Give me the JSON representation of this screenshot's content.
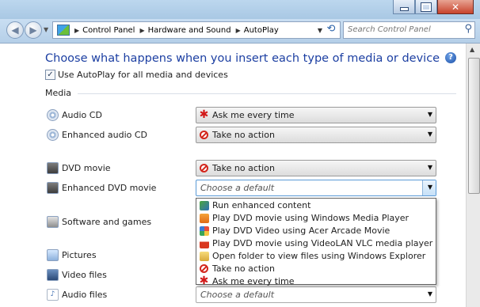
{
  "nav": {
    "breadcrumbs": [
      "Control Panel",
      "Hardware and Sound",
      "AutoPlay"
    ],
    "search_placeholder": "Search Control Panel"
  },
  "page": {
    "heading": "Choose what happens when you insert each type of media or device",
    "autoplay_checkbox_label": "Use AutoPlay for all media and devices",
    "autoplay_checked": true,
    "section_label": "Media"
  },
  "media": [
    {
      "label": "Audio CD",
      "icon": "audio-cd-icon",
      "value": "Ask me every time",
      "value_icon": "ask-icon"
    },
    {
      "label": "Enhanced audio CD",
      "icon": "enhanced-audio-cd-icon",
      "value": "Take no action",
      "value_icon": "no-action-icon"
    },
    {
      "label": "DVD movie",
      "icon": "dvd-movie-icon",
      "value": "Take no action",
      "value_icon": "no-action-icon"
    },
    {
      "label": "Enhanced DVD movie",
      "icon": "enhanced-dvd-icon",
      "value": "Choose a default",
      "value_icon": ""
    },
    {
      "label": "Software and games",
      "icon": "software-icon",
      "value": "",
      "value_icon": ""
    },
    {
      "label": "Pictures",
      "icon": "pictures-icon",
      "value": "",
      "value_icon": ""
    },
    {
      "label": "Video files",
      "icon": "video-icon",
      "value": "",
      "value_icon": ""
    },
    {
      "label": "Audio files",
      "icon": "audio-files-icon",
      "value": "Choose a default",
      "value_icon": ""
    }
  ],
  "dropdown_options": [
    {
      "label": "Run enhanced content",
      "icon": "run-content-icon"
    },
    {
      "label": "Play DVD movie using Windows Media Player",
      "icon": "wmp-icon"
    },
    {
      "label": "Play DVD Video using Acer Arcade Movie",
      "icon": "acer-arcade-icon"
    },
    {
      "label": "Play DVD movie using VideoLAN VLC media player",
      "icon": "vlc-icon"
    },
    {
      "label": "Open folder to view files using Windows Explorer",
      "icon": "folder-icon"
    },
    {
      "label": "Take no action",
      "icon": "no-action-icon"
    },
    {
      "label": "Ask me every time",
      "icon": "ask-icon"
    }
  ],
  "colors": {
    "heading": "#1c3fa2",
    "titlebar": "#bcd7ee",
    "close_button": "#c7432c"
  }
}
